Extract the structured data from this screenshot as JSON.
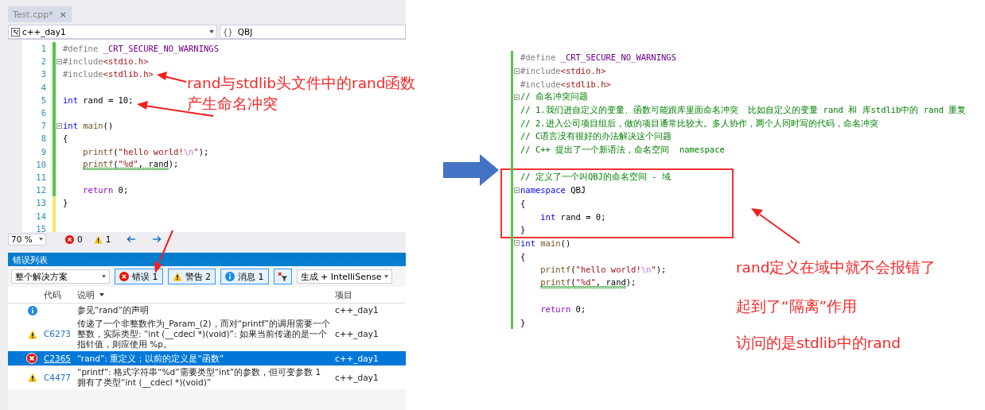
{
  "editor": {
    "tab": {
      "label": "Test.cpp*",
      "close": "×"
    },
    "nav": {
      "project": "c++_day1",
      "scope_icon": "{}",
      "scope": "QBJ"
    },
    "lines": [
      {
        "number": "1",
        "saved": true,
        "segments": [
          {
            "text": "#define ",
            "kind": "pp"
          },
          {
            "text": "_CRT_SECURE_NO_WARNINGS",
            "kind": "macro"
          }
        ]
      },
      {
        "number": "2",
        "saved": true,
        "fold": true,
        "segments": [
          {
            "text": "#include",
            "kind": "pp"
          },
          {
            "text": "<stdio.h>",
            "kind": "inc"
          }
        ]
      },
      {
        "number": "3",
        "saved": true,
        "segments": [
          {
            "text": "#include",
            "kind": "pp"
          },
          {
            "text": "<stdlib.h>",
            "kind": "inc"
          }
        ]
      },
      {
        "number": "4",
        "saved": true
      },
      {
        "number": "5",
        "saved": true,
        "segments": [
          {
            "text": "int",
            "kind": "kw"
          },
          {
            "text": " rand = 10;",
            "kind": "txt"
          }
        ]
      },
      {
        "number": "6",
        "saved": true
      },
      {
        "number": "7",
        "saved": true,
        "fold": true,
        "segments": [
          {
            "text": "int",
            "kind": "kw"
          },
          {
            "text": " main",
            "kind": "fn"
          },
          {
            "text": "()",
            "kind": "txt"
          }
        ]
      },
      {
        "number": "8",
        "saved": true,
        "segments": [
          {
            "text": "{",
            "kind": "txt"
          }
        ]
      },
      {
        "number": "9",
        "saved": true,
        "indented": true,
        "segments": [
          {
            "text": "printf",
            "kind": "fn"
          },
          {
            "text": "(",
            "kind": "txt"
          },
          {
            "text": "\"hello world!",
            "kind": "str"
          },
          {
            "text": "\\n",
            "kind": "esc"
          },
          {
            "text": "\"",
            "kind": "str"
          },
          {
            "text": ");",
            "kind": "txt"
          }
        ]
      },
      {
        "number": "10",
        "saved": true,
        "indented": true,
        "segments": [
          {
            "text": "printf",
            "kind": "fn",
            "squiggle": true
          },
          {
            "text": "(",
            "kind": "txt",
            "squiggle": true
          },
          {
            "text": "\"%d\"",
            "kind": "str",
            "squiggle": true
          },
          {
            "text": ", rand",
            "kind": "txt",
            "squiggle": true
          },
          {
            "text": ");",
            "kind": "txt"
          }
        ]
      },
      {
        "number": "11",
        "saved": true
      },
      {
        "number": "12",
        "saved": true,
        "indented": true,
        "segments": [
          {
            "text": "return",
            "kind": "ctl"
          },
          {
            "text": " 0;",
            "kind": "txt"
          }
        ]
      },
      {
        "number": "13",
        "saved": false,
        "segments": [
          {
            "text": "}",
            "kind": "txt"
          }
        ]
      },
      {
        "number": "14",
        "saved": false
      },
      {
        "number": "15",
        "saved": false
      }
    ],
    "status": {
      "zoom": "70 %",
      "errors": "0",
      "warnings": "1"
    }
  },
  "error_list": {
    "title": "错误列表",
    "scope": "整个解决方案",
    "filters": [
      {
        "kind": "error",
        "label": "错误 1",
        "selected": true
      },
      {
        "kind": "warning",
        "label": "警告 2",
        "selected": true
      },
      {
        "kind": "info",
        "label": "消息 1",
        "selected": true
      }
    ],
    "source": "生成 + IntelliSense",
    "columns": [
      "代码",
      "说明",
      "项目"
    ],
    "rows": [
      {
        "kind": "info",
        "description": "参见“rand”的声明",
        "project": "c++_day1",
        "selected": false
      },
      {
        "kind": "warning",
        "code": "C6273",
        "description": "传递了一个非整数作为_Param_(2)，而对“printf”的调用需要一个整数，实际类型: “int (__cdecl *)(void)”: 如果当前传递的是一个指针值，则应使用 %p。",
        "project": "c++_day1",
        "selected": false
      },
      {
        "kind": "error",
        "code": "C2365",
        "description": "“rand”: 重定义；以前的定义是“函数”",
        "project": "c++_day1",
        "selected": true
      },
      {
        "kind": "warning",
        "code": "C4477",
        "description": "“printf”: 格式字符串“%d”需要类型“int”的参数，但可变参数 1 拥有了类型“int (__cdecl *)(void)”",
        "project": "c++_day1",
        "selected": false
      }
    ]
  },
  "right_code": {
    "blocks": [
      {
        "boxed": false,
        "lines": [
          {
            "saved": true,
            "segments": [
              {
                "text": "#define ",
                "kind": "pp"
              },
              {
                "text": "_CRT_SECURE_NO_WARNINGS",
                "kind": "macro"
              }
            ]
          },
          {
            "saved": true,
            "fold": true,
            "segments": [
              {
                "text": "#include",
                "kind": "pp"
              },
              {
                "text": "<stdio.h>",
                "kind": "inc"
              }
            ]
          },
          {
            "saved": true,
            "segments": [
              {
                "text": "#include",
                "kind": "pp"
              },
              {
                "text": "<stdlib.h>",
                "kind": "inc"
              }
            ]
          },
          {
            "saved": true,
            "fold": true,
            "segments": [
              {
                "text": "// 命名冲突问题",
                "kind": "cm"
              }
            ]
          },
          {
            "saved": true,
            "segments": [
              {
                "text": "// 1.我们进自定义的变量、函数可能跟库里面命名冲突  比如自定义的变量 rand 和 库stdlib中的 rand 重复",
                "kind": "cm"
              }
            ]
          },
          {
            "saved": true,
            "segments": [
              {
                "text": "// 2.进入公司项目组后，做的项目通常比较大。多人协作，两个人同时写的代码，命名冲突",
                "kind": "cm"
              }
            ]
          },
          {
            "saved": true,
            "segments": [
              {
                "text": "// C语言没有很好的办法解决这个问题",
                "kind": "cm"
              }
            ]
          },
          {
            "saved": true,
            "segments": [
              {
                "text": "// C++ 提出了一个新语法，命名空间  namespace",
                "kind": "cm"
              }
            ]
          },
          {
            "saved": true
          }
        ]
      },
      {
        "boxed": true,
        "lines": [
          {
            "saved": true,
            "segments": [
              {
                "text": "// 定义了一个叫QBJ的命名空间 - 域",
                "kind": "cm"
              }
            ]
          },
          {
            "saved": true,
            "fold": true,
            "segments": [
              {
                "text": "namespace",
                "kind": "kw"
              },
              {
                "text": " QBJ",
                "kind": "txt"
              }
            ]
          },
          {
            "saved": true,
            "segments": [
              {
                "text": "{",
                "kind": "txt"
              }
            ]
          },
          {
            "saved": true,
            "indented": true,
            "segments": [
              {
                "text": "int",
                "kind": "kw"
              },
              {
                "text": " rand = 0;",
                "kind": "txt"
              }
            ]
          },
          {
            "saved": true,
            "segments": [
              {
                "text": "}",
                "kind": "txt"
              }
            ]
          }
        ]
      },
      {
        "boxed": false,
        "lines": [
          {
            "saved": true,
            "fold": true,
            "segments": [
              {
                "text": "int",
                "kind": "kw"
              },
              {
                "text": " main",
                "kind": "fn"
              },
              {
                "text": "()",
                "kind": "txt"
              }
            ]
          },
          {
            "saved": true,
            "segments": [
              {
                "text": "{",
                "kind": "txt"
              }
            ]
          },
          {
            "saved": true,
            "indented": true,
            "segments": [
              {
                "text": "printf",
                "kind": "fn"
              },
              {
                "text": "(",
                "kind": "txt"
              },
              {
                "text": "\"hello world!",
                "kind": "str"
              },
              {
                "text": "\\n",
                "kind": "esc"
              },
              {
                "text": "\"",
                "kind": "str"
              },
              {
                "text": ");",
                "kind": "txt"
              }
            ]
          },
          {
            "saved": true,
            "indented": true,
            "segments": [
              {
                "text": "printf",
                "kind": "fn",
                "squiggle": true
              },
              {
                "text": "(",
                "kind": "txt",
                "squiggle": true
              },
              {
                "text": "\"%d\"",
                "kind": "str",
                "squiggle": true
              },
              {
                "text": ", rand",
                "kind": "txt",
                "squiggle": true
              },
              {
                "text": ");",
                "kind": "txt"
              }
            ]
          },
          {
            "saved": true
          },
          {
            "saved": true,
            "indented": true,
            "segments": [
              {
                "text": "return",
                "kind": "ctl"
              },
              {
                "text": " 0;",
                "kind": "txt"
              }
            ]
          },
          {
            "saved": true,
            "segments": [
              {
                "text": "}",
                "kind": "txt"
              }
            ]
          }
        ]
      }
    ]
  },
  "annotations": [
    {
      "lines": [
        "rand与stdlib头文件中的rand函数",
        "产生命名冲突"
      ]
    },
    {
      "lines": [
        "rand定义在域中就不会报错了"
      ]
    },
    {
      "lines": [
        "起到了“隔离”作用"
      ]
    },
    {
      "lines": [
        "访问的是stdlib中的rand"
      ]
    }
  ]
}
